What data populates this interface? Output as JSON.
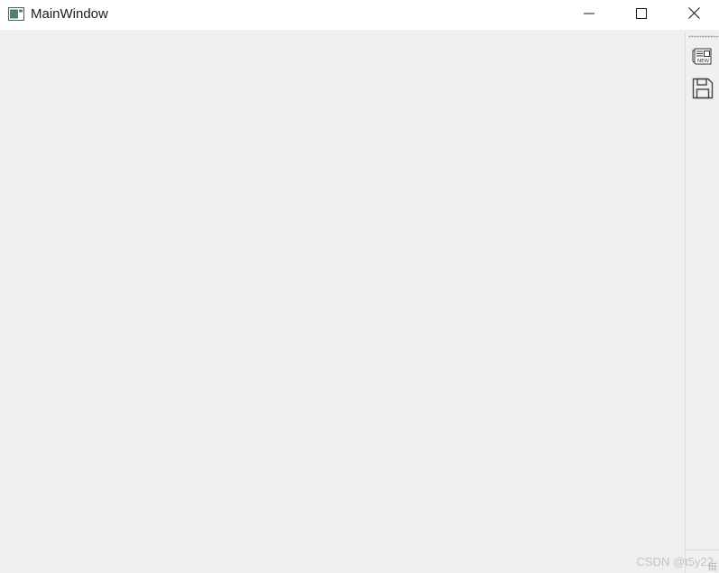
{
  "window": {
    "title": "MainWindow",
    "app_icon": "app-window-icon"
  },
  "caption_buttons": {
    "minimize": "minimize-icon",
    "maximize": "maximize-icon",
    "close": "close-icon"
  },
  "toolbar": {
    "items": [
      {
        "name": "new",
        "icon": "newspaper-new-icon"
      },
      {
        "name": "save",
        "icon": "floppy-disk-icon"
      }
    ]
  },
  "watermark": {
    "text": "CSDN @t5y22"
  }
}
